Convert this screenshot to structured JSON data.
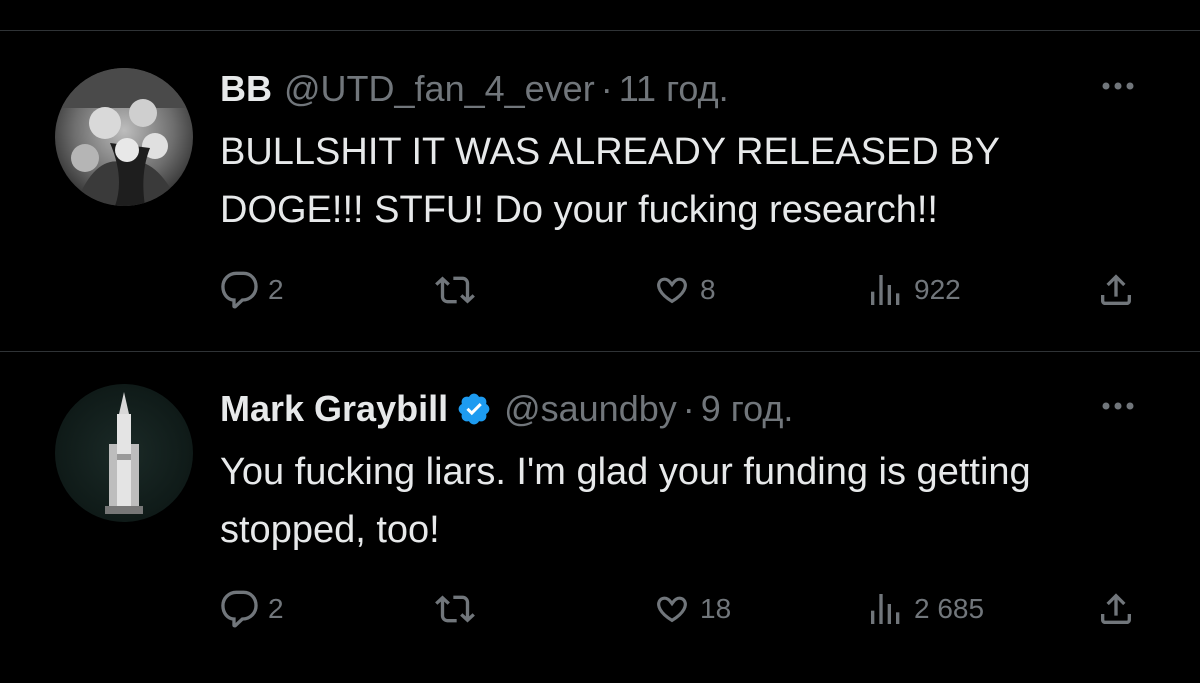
{
  "tweets": [
    {
      "name": "BB",
      "handle": "@UTD_fan_4_ever",
      "separator": "·",
      "time": "11 год.",
      "verified": false,
      "text": "BULLSHIT IT WAS ALREADY RELEASED BY DOGE!!! STFU! Do your fucking research!!",
      "replies": "2",
      "reposts": "",
      "likes": "8",
      "views": "922"
    },
    {
      "name": "Mark Graybill",
      "handle": "@saundby",
      "separator": "·",
      "time": "9 год.",
      "verified": true,
      "text": "You fucking liars. I'm glad your funding is getting stopped, too!",
      "replies": "2",
      "reposts": "",
      "likes": "18",
      "views": "2 685"
    }
  ],
  "colors": {
    "background": "#000000",
    "text": "#e7e9ea",
    "muted": "#71767b",
    "divider": "#2f3336",
    "verified": "#1d9bf0"
  },
  "icons": {
    "reply": "reply-icon",
    "repost": "repost-icon",
    "like": "heart-icon",
    "views": "views-chart-icon",
    "share": "share-icon",
    "more": "more-dots-icon",
    "verified": "verified-badge-icon"
  }
}
